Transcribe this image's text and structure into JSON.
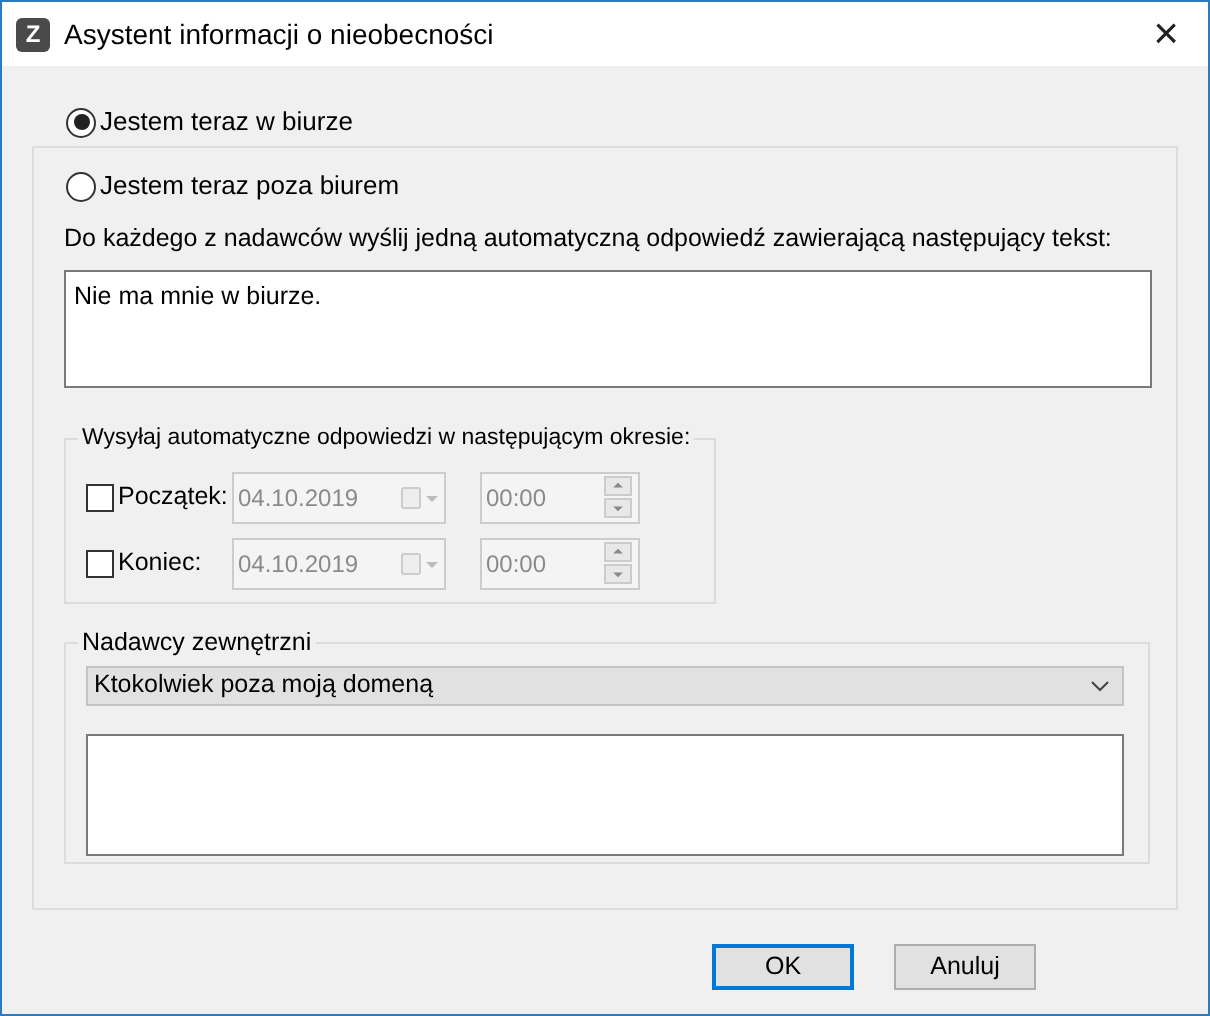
{
  "window": {
    "app_icon": "Z",
    "title": "Asystent informacji o nieobecności",
    "close": "×"
  },
  "modes": [
    {
      "label": "Jestem teraz w biurze",
      "selected": true
    },
    {
      "label": "Jestem teraz poza biurem",
      "selected": false
    }
  ],
  "reply_label": "Do każdego z nadawców wyślij jedną automatyczną odpowiedź zawierającą następujący tekst:",
  "reply_text": "Nie ma mnie w biurze.",
  "period": {
    "title": "Wysyłaj automatyczne odpowiedzi w następującym okresie:",
    "rows": [
      {
        "label": "Początek:",
        "checked": false,
        "date": "04.10.2019",
        "time": "00:00"
      },
      {
        "label": "Koniec:",
        "checked": false,
        "date": "04.10.2019",
        "time": "00:00"
      }
    ]
  },
  "external": {
    "title": "Nadawcy zewnętrzni",
    "audience": "Ktokolwiek poza moją domeną"
  },
  "buttons": [
    {
      "label": "OK",
      "default": true
    },
    {
      "label": "Anuluj",
      "default": false
    }
  ]
}
